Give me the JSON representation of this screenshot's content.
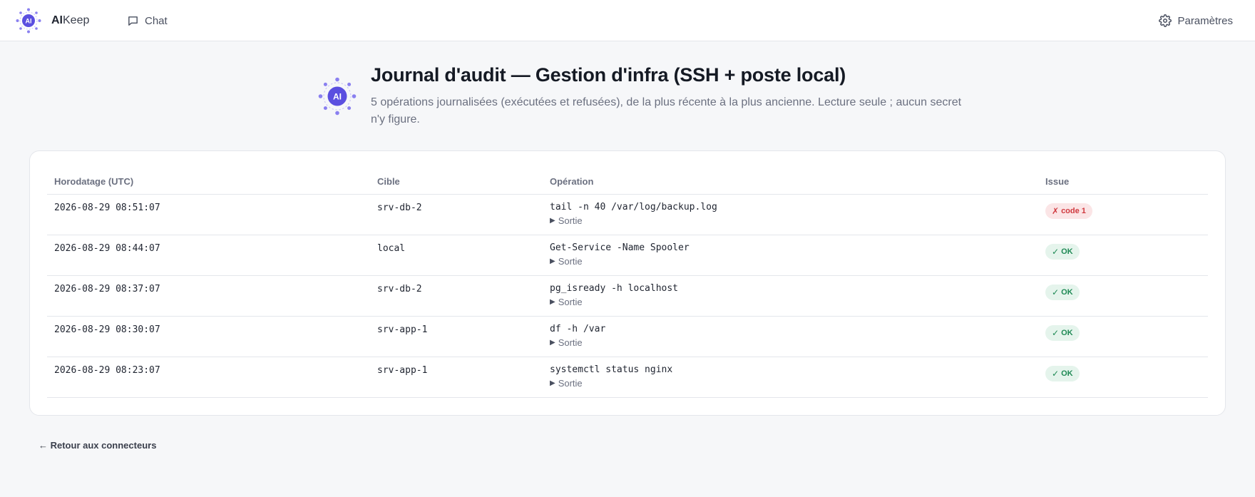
{
  "app": {
    "brand_bold": "AI",
    "brand_rest": "Keep",
    "logo_text": "AI"
  },
  "nav": {
    "chat_label": "Chat",
    "settings_label": "Paramètres"
  },
  "header": {
    "logo_text": "AI",
    "title": "Journal d'audit — Gestion d'infra (SSH + poste local)",
    "description": "5 opérations journalisées (exécutées et refusées), de la plus récente à la plus ancienne. Lecture seule ; aucun secret n'y figure."
  },
  "table": {
    "columns": [
      "Horodatage (UTC)",
      "Cible",
      "Opération",
      "Issue"
    ],
    "output_label": "Sortie",
    "rows": [
      {
        "timestamp": "2026-08-29 08:51:07",
        "target": "srv-db-2",
        "command": "tail -n 40 /var/log/backup.log",
        "status": "err",
        "status_icon": "✗",
        "status_text": "code 1"
      },
      {
        "timestamp": "2026-08-29 08:44:07",
        "target": "local",
        "command": "Get-Service -Name Spooler",
        "status": "ok",
        "status_icon": "✓",
        "status_text": "OK"
      },
      {
        "timestamp": "2026-08-29 08:37:07",
        "target": "srv-db-2",
        "command": "pg_isready -h localhost",
        "status": "ok",
        "status_icon": "✓",
        "status_text": "OK"
      },
      {
        "timestamp": "2026-08-29 08:30:07",
        "target": "srv-app-1",
        "command": "df -h /var",
        "status": "ok",
        "status_icon": "✓",
        "status_text": "OK"
      },
      {
        "timestamp": "2026-08-29 08:23:07",
        "target": "srv-app-1",
        "command": "systemctl status nginx",
        "status": "ok",
        "status_icon": "✓",
        "status_text": "OK"
      }
    ]
  },
  "footer": {
    "back_label": "← Retour aux connecteurs"
  },
  "colors": {
    "accent": "#5b4fe0",
    "ok_bg": "#e5f4ec",
    "ok_fg": "#1f8a55",
    "err_bg": "#fbe5e6",
    "err_fg": "#d0393f"
  },
  "icons": {
    "chat": "chat-bubble-icon",
    "settings": "gear-icon",
    "expand": "triangle-right-icon"
  }
}
